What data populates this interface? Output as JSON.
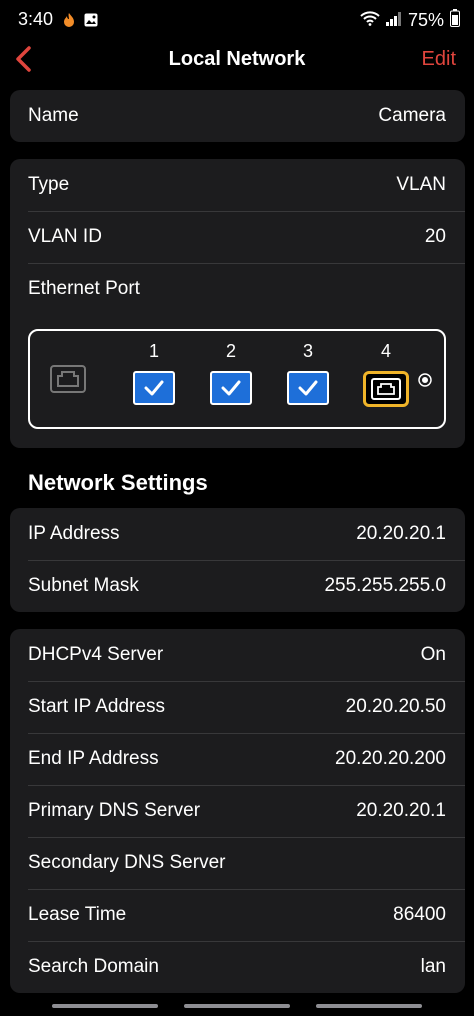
{
  "status_bar": {
    "time": "3:40",
    "battery": "75%"
  },
  "nav": {
    "title": "Local Network",
    "edit": "Edit"
  },
  "name_row": {
    "label": "Name",
    "value": "Camera"
  },
  "vlan": {
    "type_label": "Type",
    "type_value": "VLAN",
    "id_label": "VLAN ID",
    "id_value": "20",
    "ethernet_label": "Ethernet Port",
    "ports": [
      {
        "number": "1",
        "state": "checked"
      },
      {
        "number": "2",
        "state": "checked"
      },
      {
        "number": "3",
        "state": "checked"
      },
      {
        "number": "4",
        "state": "lan-selected"
      }
    ]
  },
  "network_settings": {
    "title": "Network Settings",
    "ip_label": "IP Address",
    "ip_value": "20.20.20.1",
    "subnet_label": "Subnet Mask",
    "subnet_value": "255.255.255.0"
  },
  "dhcp": {
    "rows": [
      {
        "label": "DHCPv4 Server",
        "value": "On"
      },
      {
        "label": "Start IP Address",
        "value": "20.20.20.50"
      },
      {
        "label": "End IP Address",
        "value": "20.20.20.200"
      },
      {
        "label": "Primary DNS Server",
        "value": "20.20.20.1"
      },
      {
        "label": "Secondary DNS Server",
        "value": ""
      },
      {
        "label": "Lease Time",
        "value": "86400"
      },
      {
        "label": "Search Domain",
        "value": "lan"
      }
    ]
  },
  "colors": {
    "accent": "#e0453d",
    "card": "#1c1c1e",
    "check": "#1e6fd9",
    "lan_border": "#f0b429"
  }
}
